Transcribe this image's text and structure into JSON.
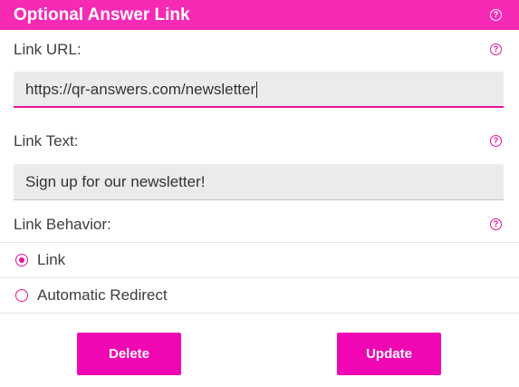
{
  "header": {
    "title": "Optional Answer Link",
    "help_icon": "question-circle-icon"
  },
  "link_url": {
    "label": "Link URL:",
    "value": "https://qr-answers.com/newsletter",
    "help_icon": "question-circle-icon"
  },
  "link_text": {
    "label": "Link Text:",
    "value": "Sign up for our newsletter!",
    "help_icon": "question-circle-icon"
  },
  "link_behavior": {
    "label": "Link Behavior:",
    "help_icon": "question-circle-icon",
    "options": [
      {
        "label": "Link",
        "selected": true
      },
      {
        "label": "Automatic Redirect",
        "selected": false
      }
    ]
  },
  "actions": {
    "delete_label": "Delete",
    "update_label": "Update"
  },
  "colors": {
    "accent": "#f72ab6",
    "button": "#f007b3",
    "icon": "#e8129e",
    "input_bg": "#ebebeb"
  },
  "help_glyph": "?"
}
